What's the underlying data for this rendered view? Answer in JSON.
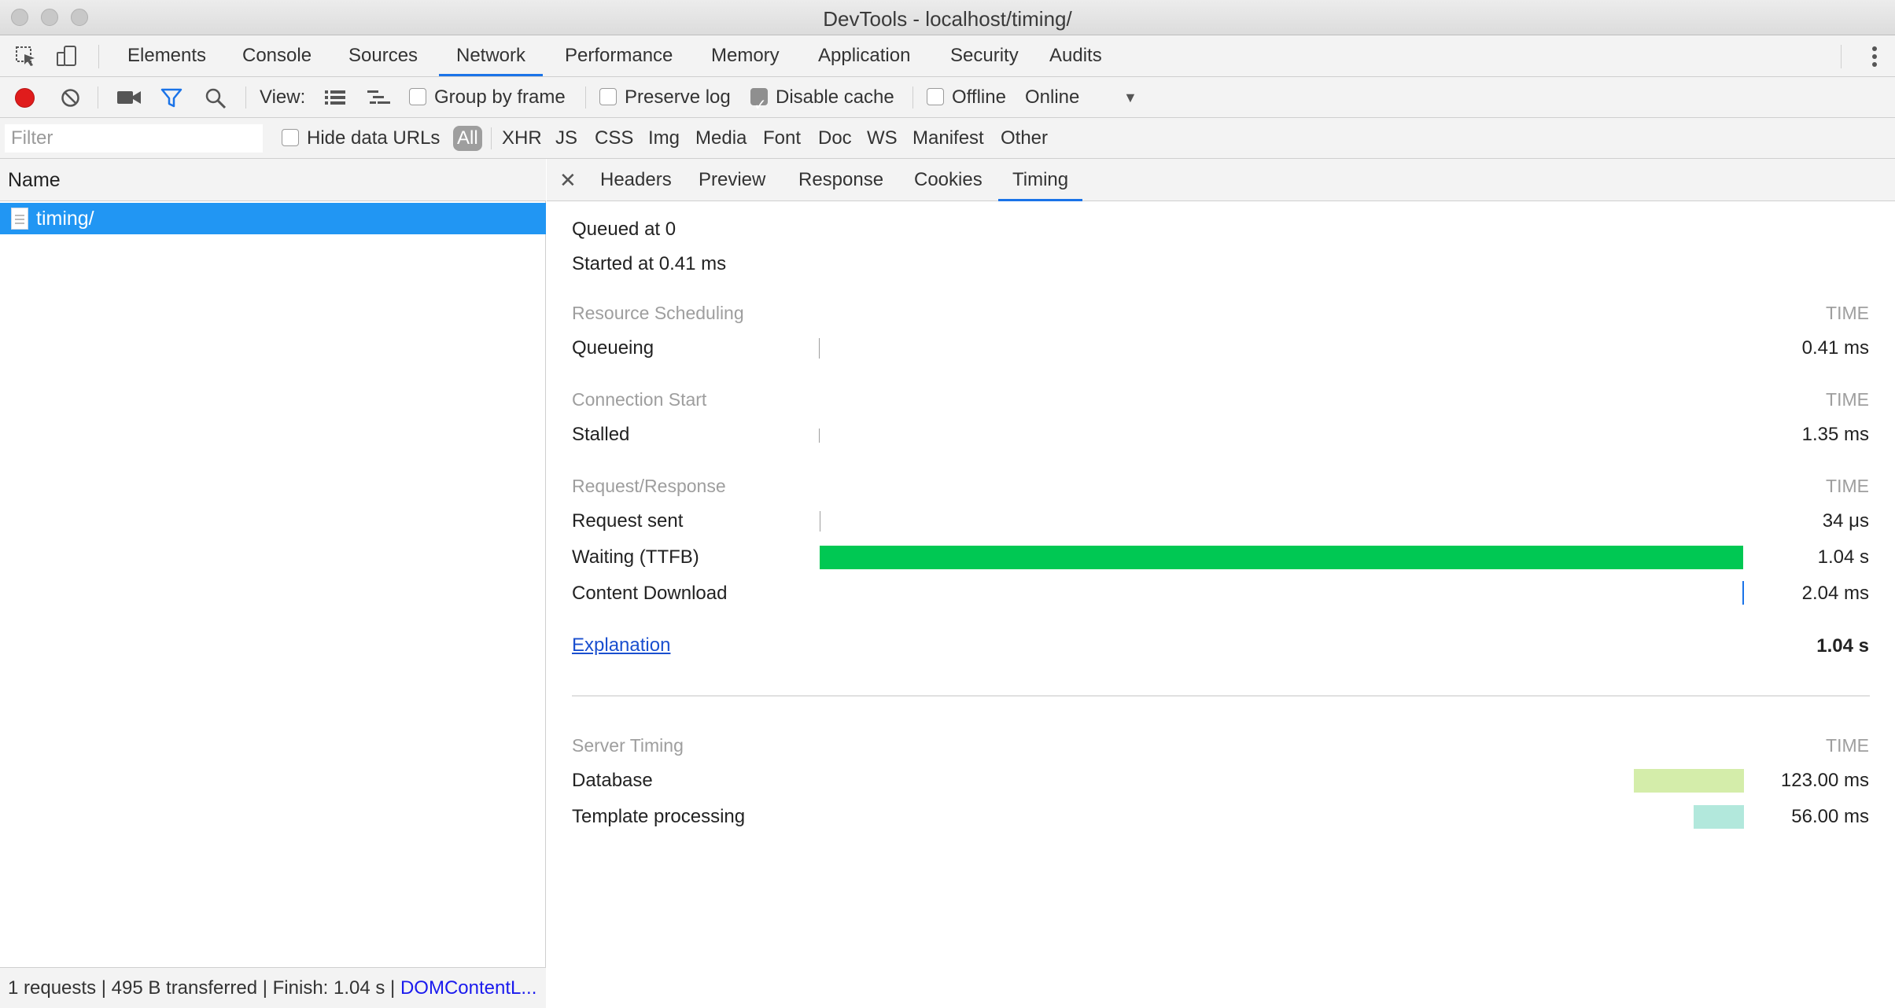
{
  "window": {
    "title": "DevTools - localhost/timing/"
  },
  "main_tabs": [
    "Elements",
    "Console",
    "Sources",
    "Network",
    "Performance",
    "Memory",
    "Application",
    "Security",
    "Audits"
  ],
  "active_main_tab": "Network",
  "toolbar": {
    "view_label": "View:",
    "group_by_frame": "Group by frame",
    "preserve_log": "Preserve log",
    "disable_cache": "Disable cache",
    "offline": "Offline",
    "throttle_value": "Online",
    "disable_cache_checked": true
  },
  "filter": {
    "placeholder": "Filter",
    "hide_data_urls": "Hide data URLs",
    "types": [
      "All",
      "XHR",
      "JS",
      "CSS",
      "Img",
      "Media",
      "Font",
      "Doc",
      "WS",
      "Manifest",
      "Other"
    ],
    "active_type": "All"
  },
  "request_list": {
    "header": "Name",
    "rows": [
      {
        "name": "timing/"
      }
    ]
  },
  "status": {
    "summary": "1 requests | 495 B transferred | Finish: 1.04 s | ",
    "dom_link": "DOMContentL..."
  },
  "detail_tabs": [
    "Headers",
    "Preview",
    "Response",
    "Cookies",
    "Timing"
  ],
  "active_detail_tab": "Timing",
  "timing": {
    "queued_at": "Queued at 0",
    "started_at": "Started at 0.41 ms",
    "time_header": "TIME",
    "sections": [
      {
        "title": "Resource Scheduling",
        "rows": [
          {
            "label": "Queueing",
            "value": "0.41 ms"
          }
        ]
      },
      {
        "title": "Connection Start",
        "rows": [
          {
            "label": "Stalled",
            "value": "1.35 ms"
          }
        ]
      },
      {
        "title": "Request/Response",
        "rows": [
          {
            "label": "Request sent",
            "value": "34 μs"
          },
          {
            "label": "Waiting (TTFB)",
            "value": "1.04 s"
          },
          {
            "label": "Content Download",
            "value": "2.04 ms"
          }
        ]
      }
    ],
    "explanation": "Explanation",
    "total": "1.04 s",
    "server_timing": {
      "title": "Server Timing",
      "rows": [
        {
          "label": "Database",
          "value": "123.00 ms",
          "color": "#d4edaa"
        },
        {
          "label": "Template processing",
          "value": "56.00 ms",
          "color": "#b2e8dc"
        }
      ]
    }
  },
  "colors": {
    "ttfb_bar": "#00c853",
    "accent": "#1a73e8",
    "selected_row": "#2196f3",
    "record": "#e01c1c"
  }
}
